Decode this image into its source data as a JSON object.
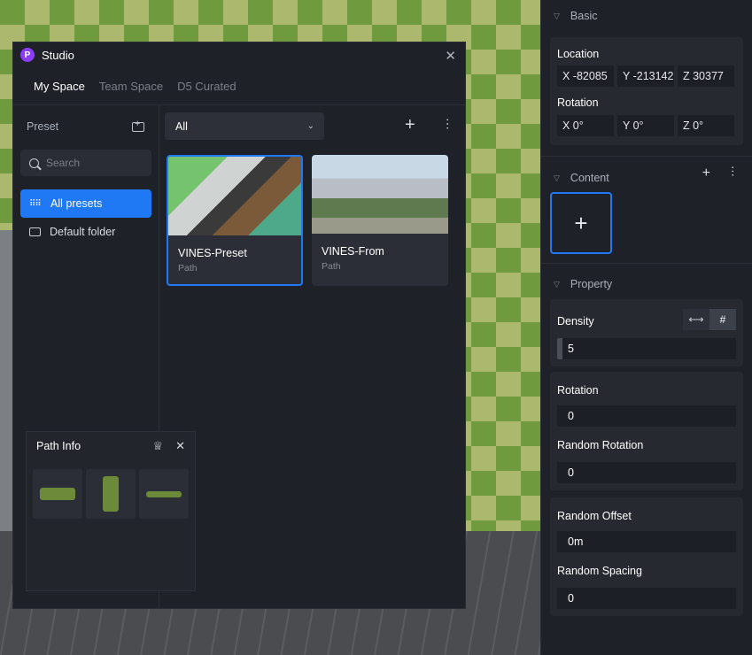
{
  "studio": {
    "title": "Studio",
    "logo": "P",
    "tabs": [
      "My Space",
      "Team Space",
      "D5 Curated"
    ],
    "sidebar": {
      "heading": "Preset",
      "search_placeholder": "Search",
      "items": [
        {
          "label": "All presets"
        },
        {
          "label": "Default folder"
        }
      ]
    },
    "filter": "All",
    "cards": [
      {
        "name": "VINES-Preset",
        "type": "Path"
      },
      {
        "name": "VINES-From",
        "type": "Path"
      }
    ]
  },
  "path_info": {
    "title": "Path Info"
  },
  "panel": {
    "basic": {
      "heading": "Basic",
      "location_label": "Location",
      "location": {
        "x": "X  -82085",
        "y": "Y  -213142",
        "z": "Z  30377"
      },
      "rotation_label": "Rotation",
      "rotation": {
        "x": "X  0°",
        "y": "Y  0°",
        "z": "Z  0°"
      }
    },
    "content": {
      "heading": "Content"
    },
    "property": {
      "heading": "Property",
      "density_label": "Density",
      "density": "5",
      "rotation_label": "Rotation",
      "rotation": "0",
      "random_rotation_label": "Random Rotation",
      "random_rotation": "0",
      "random_offset_label": "Random Offset",
      "random_offset": "0m",
      "random_spacing_label": "Random Spacing",
      "random_spacing": "0"
    }
  }
}
